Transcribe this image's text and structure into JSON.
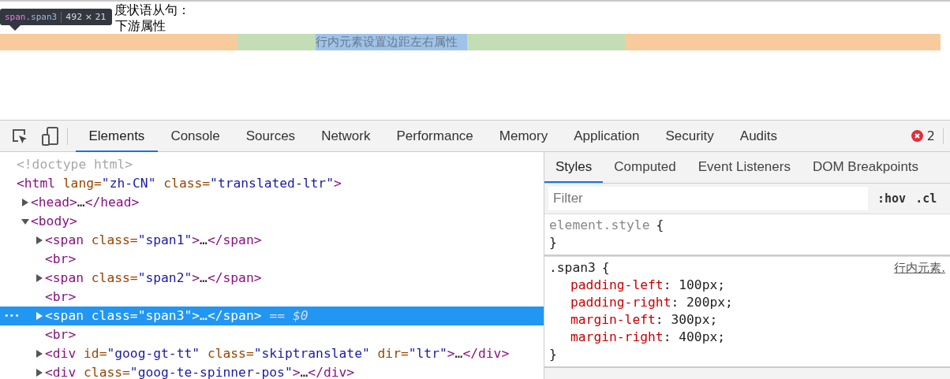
{
  "page": {
    "lines": [
      "度状语从句：",
      "下游属性"
    ],
    "highlighted_span": "行内元素设置边距左右属性"
  },
  "tooltip": {
    "tag": "span",
    "class": ".span3",
    "size": "492 × 21"
  },
  "devtools": {
    "tabs": [
      {
        "label": "Elements",
        "selected": true
      },
      {
        "label": "Console",
        "selected": false
      },
      {
        "label": "Sources",
        "selected": false
      },
      {
        "label": "Network",
        "selected": false
      },
      {
        "label": "Performance",
        "selected": false
      },
      {
        "label": "Memory",
        "selected": false
      },
      {
        "label": "Application",
        "selected": false
      },
      {
        "label": "Security",
        "selected": false
      },
      {
        "label": "Audits",
        "selected": false
      }
    ],
    "error_count": "2",
    "dom_tree": [
      {
        "selected": false,
        "segments": [
          {
            "kind": "comment",
            "text": "<!doctype html>"
          }
        ]
      },
      {
        "selected": false,
        "segments": [
          {
            "kind": "tag",
            "text": "<html"
          },
          {
            "kind": "attr",
            "text": " lang="
          },
          {
            "kind": "value",
            "text": "\"zh-CN\""
          },
          {
            "kind": "attr",
            "text": " class="
          },
          {
            "kind": "value",
            "text": "\"translated-ltr\""
          },
          {
            "kind": "tag",
            "text": ">"
          }
        ],
        "children": [
          {
            "selected": false,
            "expanded": false,
            "segments": [
              {
                "kind": "tag",
                "text": "<head>"
              },
              {
                "kind": "plain",
                "text": "…"
              },
              {
                "kind": "tag",
                "text": "</head>"
              }
            ]
          },
          {
            "selected": false,
            "expanded": true,
            "segments": [
              {
                "kind": "tag",
                "text": "<body>"
              }
            ],
            "children": [
              {
                "selected": false,
                "expanded": false,
                "segments": [
                  {
                    "kind": "tag",
                    "text": "<span"
                  },
                  {
                    "kind": "attr",
                    "text": " class="
                  },
                  {
                    "kind": "value",
                    "text": "\"span1\""
                  },
                  {
                    "kind": "tag",
                    "text": ">"
                  },
                  {
                    "kind": "plain",
                    "text": "…"
                  },
                  {
                    "kind": "tag",
                    "text": "</span>"
                  }
                ]
              },
              {
                "selected": false,
                "segments": [
                  {
                    "kind": "tag",
                    "text": "<br>"
                  }
                ]
              },
              {
                "selected": false,
                "expanded": false,
                "segments": [
                  {
                    "kind": "tag",
                    "text": "<span"
                  },
                  {
                    "kind": "attr",
                    "text": " class="
                  },
                  {
                    "kind": "value",
                    "text": "\"span2\""
                  },
                  {
                    "kind": "tag",
                    "text": ">"
                  },
                  {
                    "kind": "plain",
                    "text": "…"
                  },
                  {
                    "kind": "tag",
                    "text": "</span>"
                  }
                ]
              },
              {
                "selected": false,
                "segments": [
                  {
                    "kind": "tag",
                    "text": "<br>"
                  }
                ]
              },
              {
                "selected": true,
                "expanded": false,
                "gutter": "•••",
                "suffix": "== $0",
                "segments": [
                  {
                    "kind": "tag",
                    "text": "<span"
                  },
                  {
                    "kind": "attr",
                    "text": " class="
                  },
                  {
                    "kind": "value",
                    "text": "\"span3\""
                  },
                  {
                    "kind": "tag",
                    "text": ">"
                  },
                  {
                    "kind": "plain",
                    "text": "…"
                  },
                  {
                    "kind": "tag",
                    "text": "</span>"
                  }
                ]
              },
              {
                "selected": false,
                "segments": [
                  {
                    "kind": "tag",
                    "text": "<br>"
                  }
                ]
              },
              {
                "selected": false,
                "expanded": false,
                "segments": [
                  {
                    "kind": "tag",
                    "text": "<div"
                  },
                  {
                    "kind": "attr",
                    "text": " id="
                  },
                  {
                    "kind": "value",
                    "text": "\"goog-gt-tt\""
                  },
                  {
                    "kind": "attr",
                    "text": " class="
                  },
                  {
                    "kind": "value",
                    "text": "\"skiptranslate\""
                  },
                  {
                    "kind": "attr",
                    "text": " dir="
                  },
                  {
                    "kind": "value",
                    "text": "\"ltr\""
                  },
                  {
                    "kind": "tag",
                    "text": ">"
                  },
                  {
                    "kind": "plain",
                    "text": "…"
                  },
                  {
                    "kind": "tag",
                    "text": "</div>"
                  }
                ]
              },
              {
                "selected": false,
                "expanded": false,
                "segments": [
                  {
                    "kind": "tag",
                    "text": "<div"
                  },
                  {
                    "kind": "attr",
                    "text": " class="
                  },
                  {
                    "kind": "value",
                    "text": "\"goog-te-spinner-pos\""
                  },
                  {
                    "kind": "tag",
                    "text": ">"
                  },
                  {
                    "kind": "plain",
                    "text": "…"
                  },
                  {
                    "kind": "tag",
                    "text": "</div>"
                  }
                ]
              }
            ]
          }
        ]
      }
    ],
    "side_tabs": [
      {
        "label": "Styles",
        "selected": true
      },
      {
        "label": "Computed",
        "selected": false
      },
      {
        "label": "Event Listeners",
        "selected": false
      },
      {
        "label": "DOM Breakpoints",
        "selected": false
      }
    ],
    "filter": {
      "placeholder": "Filter"
    },
    "filter_buttons": [
      ":hov",
      ".cl"
    ],
    "rules": [
      {
        "kind": "inline",
        "selector": "element.style",
        "open": "{",
        "close": "}"
      },
      {
        "kind": "rule",
        "selector": ".span3",
        "open": "{",
        "close": "}",
        "source": "行内元素.",
        "declarations": [
          {
            "property": "padding-left",
            "value": ": 100px;"
          },
          {
            "property": "padding-right",
            "value": ": 200px;"
          },
          {
            "property": "margin-left",
            "value": ": 300px;"
          },
          {
            "property": "margin-right",
            "value": ": 400px;"
          }
        ]
      }
    ]
  }
}
